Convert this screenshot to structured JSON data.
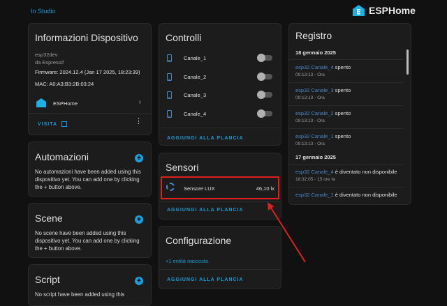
{
  "header": {
    "back_link": "In Studio",
    "brand": "ESPHome"
  },
  "device_info": {
    "title": "Informazioni Dispositivo",
    "model": "esp32dev",
    "manufacturer": "da Espressif",
    "firmware": "Firmware: 2024.12.4 (Jan 17 2025, 18:23:39)",
    "mac": "MAC: A0:A3:B3:2B:03:24",
    "integration": "ESPHome",
    "visit_label": "VISITA"
  },
  "automations": {
    "title": "Automazioni",
    "text": "No automazioni have been added using this dispositivo yet. You can add one by clicking the + button above."
  },
  "scenes": {
    "title": "Scene",
    "text": "No scene have been added using this dispositivo yet. You can add one by clicking the + button above."
  },
  "scripts": {
    "title": "Script",
    "text": "No script have been added using this"
  },
  "controls": {
    "title": "Controlli",
    "items": [
      {
        "label": "Canale_1",
        "on": false
      },
      {
        "label": "Canale_2",
        "on": false
      },
      {
        "label": "Canale_3",
        "on": false
      },
      {
        "label": "Canale_4",
        "on": false
      }
    ],
    "add_label": "AGGIUNGI ALLA PLANCIA"
  },
  "sensors": {
    "title": "Sensori",
    "items": [
      {
        "label": "Sensore LUX",
        "value": "46,10 lx"
      }
    ],
    "add_label": "AGGIUNGI ALLA PLANCIA"
  },
  "config": {
    "title": "Configurazione",
    "hidden": "+1 entità nascosta",
    "add_label": "AGGIUNGI ALLA PLANCIA"
  },
  "log": {
    "title": "Registro",
    "groups": [
      {
        "date": "18 gennaio 2025",
        "entries": [
          {
            "entity": "esp32 Canale_4",
            "action": "spento",
            "time": "09:13:13 - Ora"
          },
          {
            "entity": "esp32 Canale_3",
            "action": "spento",
            "time": "09:13:13 - Ora"
          },
          {
            "entity": "esp32 Canale_2",
            "action": "spento",
            "time": "09:13:13 - Ora"
          },
          {
            "entity": "esp32 Canale_1",
            "action": "spento",
            "time": "09:13:13 - Ora"
          }
        ]
      },
      {
        "date": "17 gennaio 2025",
        "entries": [
          {
            "entity": "esp32 Canale_4",
            "action": "è diventato non disponibile",
            "time": "18:32:05 - 15 ore fa"
          },
          {
            "entity": "esp32 Canale_1",
            "action": "è diventato non disponibile",
            "time": ""
          }
        ]
      }
    ]
  },
  "colors": {
    "accent": "#1e9bd8",
    "highlight": "#e0201e",
    "background": "#111111",
    "card": "#1c1c1c"
  }
}
